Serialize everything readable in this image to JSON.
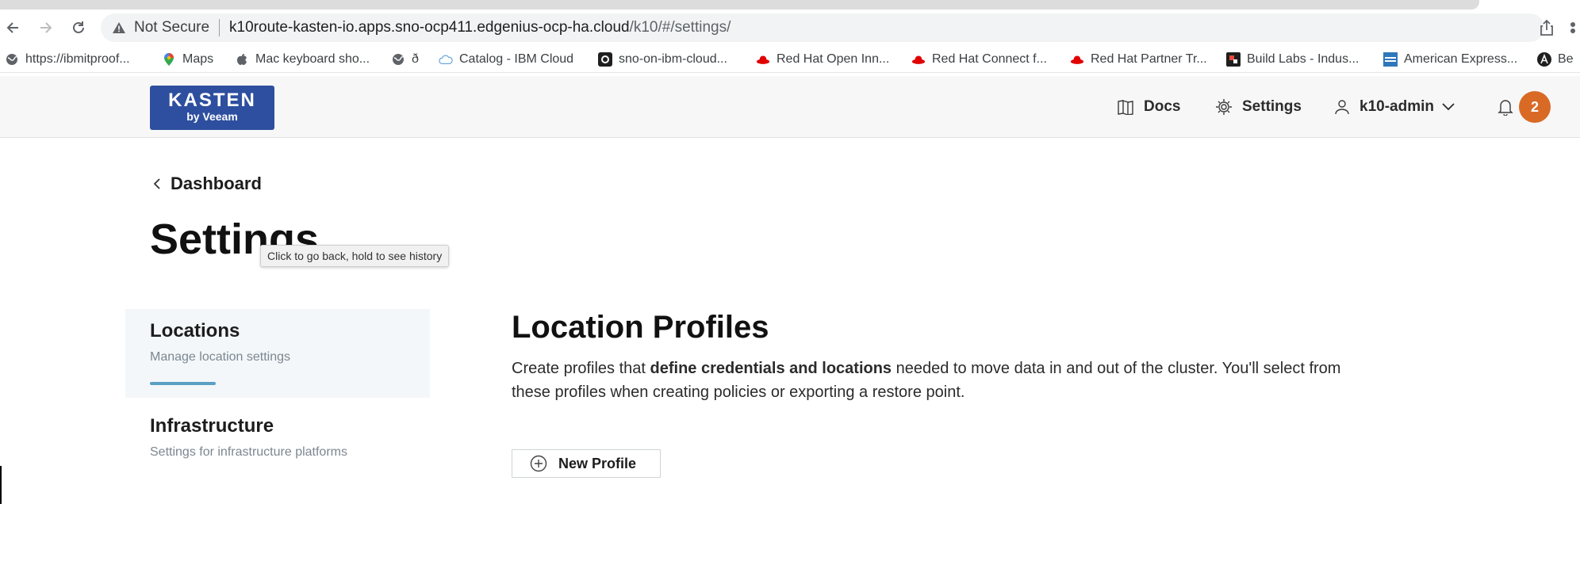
{
  "browser": {
    "omnibox": {
      "security_label": "Not Secure",
      "url_host": "k10route-kasten-io.apps.sno-ocp411.edgenius-ocp-ha.cloud",
      "url_path": "/k10/#/settings/"
    },
    "bookmarks": [
      {
        "label": "https://ibmitproof...",
        "icon": "globe-icon"
      },
      {
        "label": "Maps",
        "icon": "maps-pin-icon"
      },
      {
        "label": "Mac keyboard sho...",
        "icon": "apple-icon"
      },
      {
        "label": "ð",
        "icon": "globe-icon"
      },
      {
        "label": "Catalog - IBM Cloud",
        "icon": "cloud-icon"
      },
      {
        "label": "sno-on-ibm-cloud...",
        "icon": "github-icon"
      },
      {
        "label": "Red Hat Open Inn...",
        "icon": "redhat-icon"
      },
      {
        "label": "Red Hat Connect f...",
        "icon": "redhat-icon"
      },
      {
        "label": "Red Hat Partner Tr...",
        "icon": "redhat-icon"
      },
      {
        "label": "Build Labs - Indus...",
        "icon": "build-labs-icon"
      },
      {
        "label": "American Express...",
        "icon": "amex-icon"
      },
      {
        "label": "Be",
        "icon": "a-circle-icon"
      }
    ]
  },
  "header": {
    "logo_line1": "KASTEN",
    "logo_line2": "by Veeam",
    "docs_label": "Docs",
    "settings_label": "Settings",
    "user_label": "k10-admin",
    "notification_count": "2"
  },
  "page": {
    "breadcrumb": "Dashboard",
    "title": "Settings",
    "tooltip": "Click to go back, hold to see history"
  },
  "sidebar": {
    "items": [
      {
        "title": "Locations",
        "description": "Manage location settings",
        "active": true
      },
      {
        "title": "Infrastructure",
        "description": "Settings for infrastructure platforms",
        "active": false
      }
    ]
  },
  "main": {
    "title": "Location Profiles",
    "description_pre": "Create profiles that ",
    "description_bold": "define credentials and locations",
    "description_post": " needed to move data in and out of the cluster. You'll select from these profiles when creating policies or exporting a restore point.",
    "new_profile_label": "New Profile"
  },
  "colors": {
    "brand": "#2e4f9f",
    "badge": "#d96a26",
    "active_underline": "#5aa0c4",
    "redhat": "#e00000"
  }
}
